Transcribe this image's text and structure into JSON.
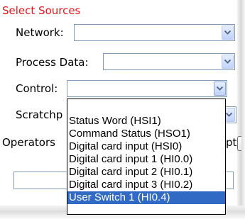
{
  "form": {
    "title": "Select Sources",
    "network_label": "Network:",
    "process_data_label": "Process Data:",
    "control_label": "Control:",
    "scratchpad_label_partial": "Scratchp",
    "operators_label_partial": "Operators",
    "operators_suffix_partial": "pt"
  },
  "control_dropdown": {
    "options": [
      "Status Word (HSI1)",
      "Command Status (HSO1)",
      "Digital card input (HSI0)",
      "Digital card input 1 (HI0.0)",
      "Digital card input 2 (HI0.1)",
      "Digital card input 3 (HI0.2)",
      "User Switch 1 (HI0.4)"
    ],
    "highlighted": "User Switch 1 (HI0.4)"
  },
  "colors": {
    "title": "#e8141c",
    "highlight": "#316ac5",
    "field_border": "#7f9db9"
  },
  "icons": {
    "dropdown_arrow": "chevron-down-icon"
  }
}
